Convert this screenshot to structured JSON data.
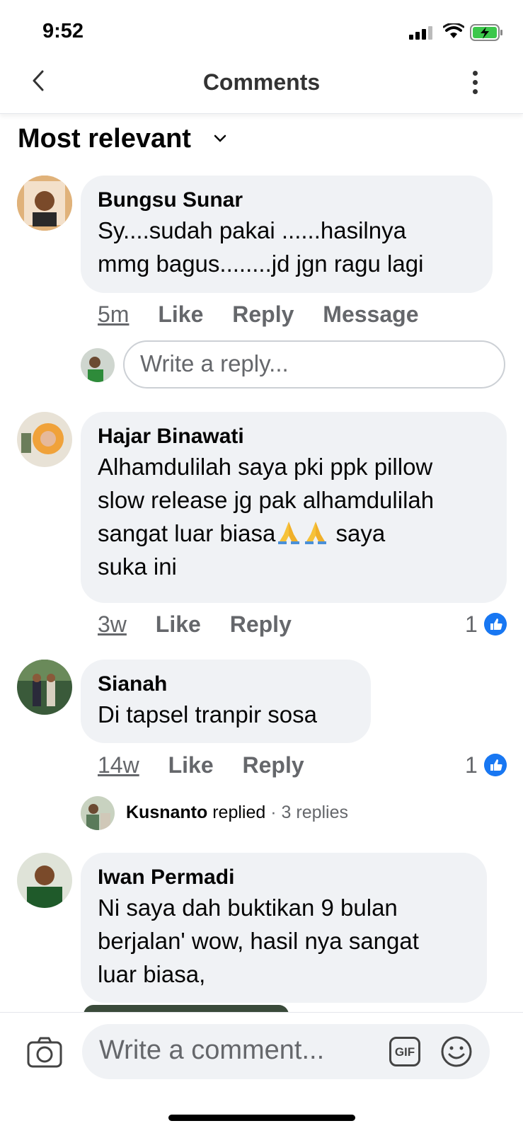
{
  "status_bar": {
    "time": "9:52"
  },
  "header": {
    "title": "Comments"
  },
  "sort": {
    "label": "Most relevant"
  },
  "comments": [
    {
      "author": "Bungsu Sunar",
      "lines": [
        "Sy....sudah pakai ......hasilnya",
        "mmg bagus........jd jgn ragu lagi"
      ],
      "time": "5m",
      "actions": [
        "Like",
        "Reply",
        "Message"
      ]
    },
    {
      "author": "Hajar Binawati",
      "lines": [
        "Alhamdulilah saya pki ppk pillow",
        "slow release jg pak alhamdulilah",
        "sangat luar biasa",
        "suka ini"
      ],
      "line3_tail": "saya",
      "time": "3w",
      "actions": [
        "Like",
        "Reply"
      ],
      "reactions": "1"
    },
    {
      "author": "Sianah",
      "lines": [
        "Di tapsel tranpir sosa"
      ],
      "time": "14w",
      "actions": [
        "Like",
        "Reply"
      ],
      "reactions": "1",
      "replied_by": "Kusnanto",
      "replied_word": "replied",
      "replies_count": "· 3 replies"
    },
    {
      "author": "Iwan Permadi",
      "lines": [
        "Ni saya dah buktikan 9 bulan",
        "berjalan' wow, hasil nya sangat",
        "luar biasa,"
      ]
    }
  ],
  "reply_input": {
    "placeholder": "Write a reply..."
  },
  "comment_input": {
    "placeholder": "Write a comment...",
    "gif_label": "GIF"
  },
  "colors": {
    "accent": "#1877f2",
    "bubble": "#f0f2f5",
    "muted": "#65676b"
  }
}
